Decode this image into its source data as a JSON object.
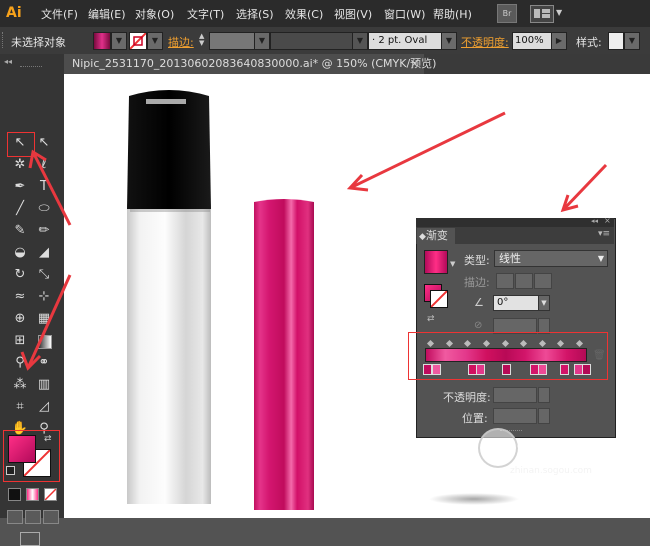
{
  "app": {
    "logo": "Ai"
  },
  "menu": [
    "文件(F)",
    "编辑(E)",
    "对象(O)",
    "文字(T)",
    "选择(S)",
    "效果(C)",
    "视图(V)",
    "窗口(W)",
    "帮助(H)"
  ],
  "menu_icons": {
    "bridge": "Br",
    "arrange": "workspace-icon"
  },
  "control_bar": {
    "selection_status": "未选择对象",
    "stroke_label": "描边:",
    "stroke_profile": "2 pt. Oval",
    "opacity_label": "不透明度:",
    "opacity_value": "100%",
    "style_label": "样式:"
  },
  "document_tab": {
    "title": "Nipic_2531170_20130602083640830000.ai* @ 150% (CMYK/预览)",
    "close": "×"
  },
  "gradient_panel": {
    "tab_label": "渐变",
    "type_label": "类型:",
    "type_value": "线性",
    "stroke_label": "描边:",
    "angle_value": "0°",
    "opacity_label": "不透明度:",
    "position_label": "位置:"
  },
  "colors": {
    "accent_magenta": "#d4116e",
    "annotation_red": "#e8383f",
    "ui_dark": "#353535",
    "panel_gray": "#535353"
  },
  "watermark": {
    "brand": "搜狗指南",
    "url": "zhinan.sogou.com"
  }
}
